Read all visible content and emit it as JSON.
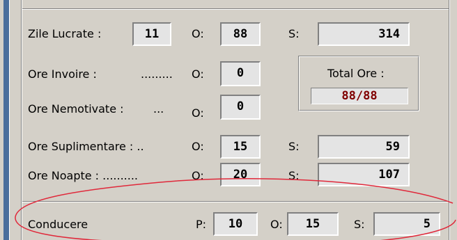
{
  "rows": {
    "zile_lucrate": {
      "label": "Zile Lucrate :",
      "value": "11",
      "o_label": "O:",
      "o_value": "88",
      "s_label": "S:",
      "s_value": "314"
    },
    "ore_invoire": {
      "label": "Ore Invoire :",
      "dots": ".........",
      "o_label": "O:",
      "o_value": "0"
    },
    "ore_nemotivate": {
      "label": "Ore Nemotivate :",
      "dots": "...",
      "o_label": "O:",
      "o_value": "0"
    },
    "ore_suplimentare": {
      "label": "Ore Suplimentare : ..",
      "o_label": "O:",
      "o_value": "15",
      "s_label": "S:",
      "s_value": "59"
    },
    "ore_noapte": {
      "label": "Ore Noapte : ..........",
      "o_label": "O:",
      "o_value": "20",
      "s_label": "S:",
      "s_value": "107"
    },
    "conducere": {
      "label": "Conducere",
      "p_label": "P:",
      "p_value": "10",
      "o_label": "O:",
      "o_value": "15",
      "s_label": "S:",
      "s_value": "5"
    }
  },
  "total": {
    "label": "Total Ore :",
    "value": "88/88"
  },
  "colors": {
    "face": "#d4d0c8",
    "field": "#e4e4e4",
    "total_text": "#800000",
    "annotation": "#e0283a",
    "left_band": "#4a6e9c"
  }
}
